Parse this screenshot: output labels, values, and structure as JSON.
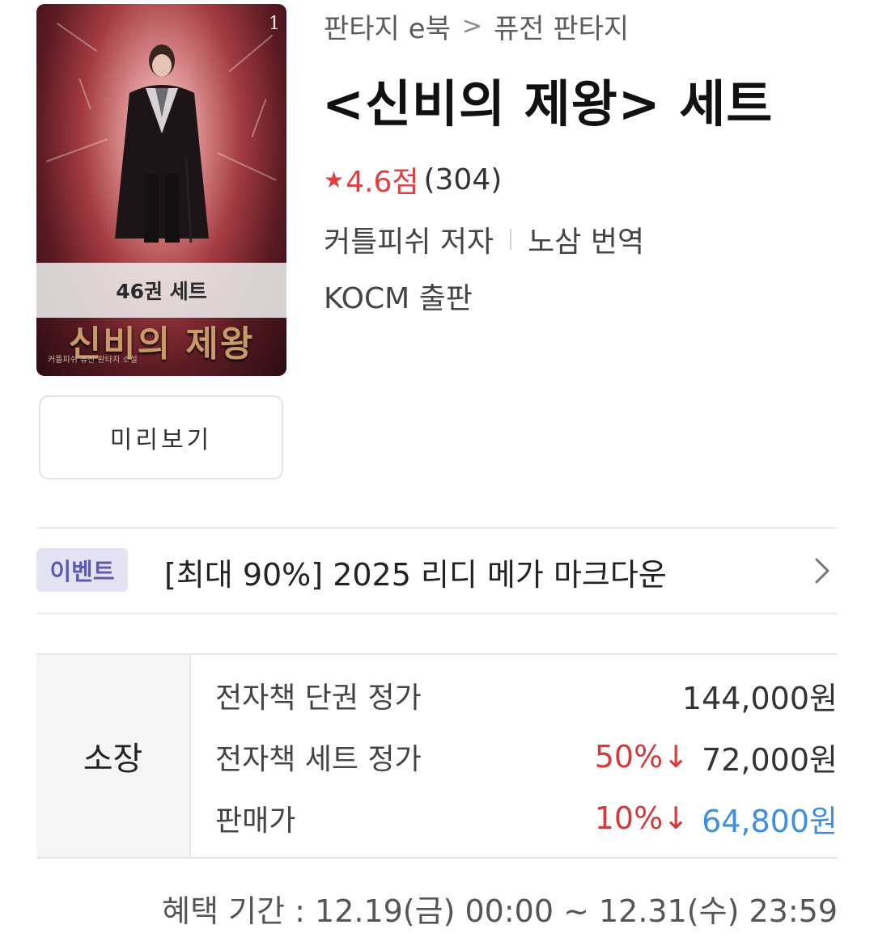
{
  "breadcrumb": {
    "category": "판타지 e북",
    "separator": ">",
    "subcategory": "퓨전 판타지"
  },
  "cover": {
    "volume_number": "1",
    "set_badge": "46권 세트",
    "title_art": "신비의 제왕",
    "subtitle_line": "커틀피쉬 퓨전 판타지 소설"
  },
  "preview_button": "미리보기",
  "title": "<신비의 제왕> 세트",
  "rating": {
    "star_icon": "star-icon",
    "score": "4.6점",
    "count": "(304)",
    "color": "#e0403f"
  },
  "author": "커틀피쉬 저자",
  "translator": "노삼 번역",
  "publisher": "KOCM 출판",
  "event": {
    "badge": "이벤트",
    "text": "[최대 90%] 2025 리디 메가 마크다운",
    "icon": "chevron-right-icon"
  },
  "pricing": {
    "section_label": "소장",
    "rows": [
      {
        "name": "전자책 단권 정가",
        "discount": "",
        "price": "144,000원"
      },
      {
        "name": "전자책 세트 정가",
        "discount": "50%↓",
        "price": "72,000원"
      },
      {
        "name": "판매가",
        "discount": "10%↓",
        "price": "64,800원"
      }
    ],
    "discount_color": "#d33a3a",
    "final_price_color": "#3f8fe0"
  },
  "benefit_period": "혜택 기간 : 12.19(금) 00:00 ~ 12.31(수) 23:59"
}
